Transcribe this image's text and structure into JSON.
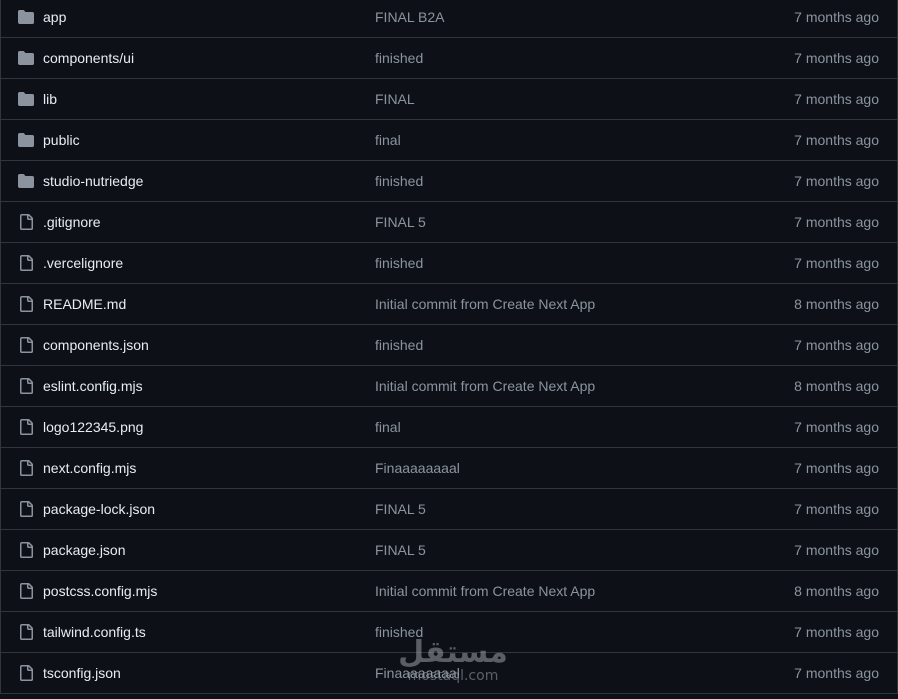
{
  "files": [
    {
      "name": "app",
      "type": "folder",
      "icon": "folder-icon",
      "commit": "FINAL B2A",
      "time": "7 months ago"
    },
    {
      "name": "components/ui",
      "type": "folder",
      "icon": "folder-icon",
      "commit": "finished",
      "time": "7 months ago"
    },
    {
      "name": "lib",
      "type": "folder",
      "icon": "folder-icon",
      "commit": "FINAL",
      "time": "7 months ago"
    },
    {
      "name": "public",
      "type": "folder",
      "icon": "folder-icon",
      "commit": "final",
      "time": "7 months ago"
    },
    {
      "name": "studio-nutriedge",
      "type": "folder",
      "icon": "folder-icon",
      "commit": "finished",
      "time": "7 months ago"
    },
    {
      "name": ".gitignore",
      "type": "file",
      "icon": "file-icon",
      "commit": "FINAL 5",
      "time": "7 months ago"
    },
    {
      "name": ".vercelignore",
      "type": "file",
      "icon": "file-icon",
      "commit": "finished",
      "time": "7 months ago"
    },
    {
      "name": "README.md",
      "type": "file",
      "icon": "file-icon",
      "commit": "Initial commit from Create Next App",
      "time": "8 months ago"
    },
    {
      "name": "components.json",
      "type": "file",
      "icon": "file-icon",
      "commit": "finished",
      "time": "7 months ago"
    },
    {
      "name": "eslint.config.mjs",
      "type": "file",
      "icon": "file-icon",
      "commit": "Initial commit from Create Next App",
      "time": "8 months ago"
    },
    {
      "name": "logo122345.png",
      "type": "file",
      "icon": "file-icon",
      "commit": "final",
      "time": "7 months ago"
    },
    {
      "name": "next.config.mjs",
      "type": "file",
      "icon": "file-icon",
      "commit": "Finaaaaaaaal",
      "time": "7 months ago"
    },
    {
      "name": "package-lock.json",
      "type": "file",
      "icon": "file-icon",
      "commit": "FINAL 5",
      "time": "7 months ago"
    },
    {
      "name": "package.json",
      "type": "file",
      "icon": "file-icon",
      "commit": "FINAL 5",
      "time": "7 months ago"
    },
    {
      "name": "postcss.config.mjs",
      "type": "file",
      "icon": "file-icon",
      "commit": "Initial commit from Create Next App",
      "time": "8 months ago"
    },
    {
      "name": "tailwind.config.ts",
      "type": "file",
      "icon": "file-icon",
      "commit": "finished",
      "time": "7 months ago"
    },
    {
      "name": "tsconfig.json",
      "type": "file",
      "icon": "file-icon",
      "commit": "Finaaaaaaaal",
      "time": "7 months ago"
    }
  ],
  "watermark": {
    "text": "مستقل",
    "domain": "mostaql.com"
  },
  "colors": {
    "background": "#0d1117",
    "border": "#30363d",
    "name_text": "#e6edf3",
    "muted_text": "#8b949e",
    "icon": "#8b949e"
  }
}
